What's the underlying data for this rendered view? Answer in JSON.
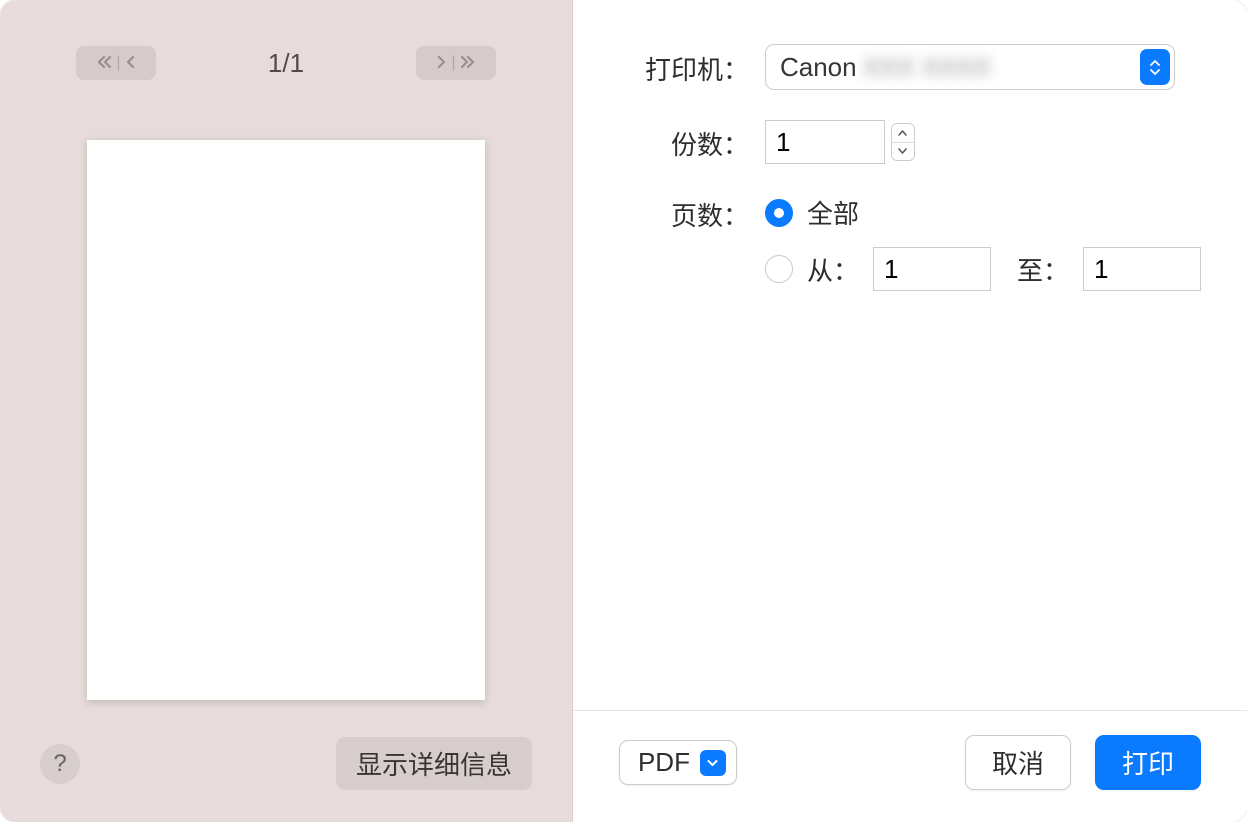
{
  "preview": {
    "page_indicator": "1/1",
    "show_details_label": "显示详细信息",
    "help_label": "?"
  },
  "form": {
    "printer_label": "打印机：",
    "printer_value": "Canon",
    "copies_label": "份数：",
    "copies_value": "1",
    "pages_label": "页数：",
    "pages_all_label": "全部",
    "pages_from_label": "从：",
    "pages_from_value": "1",
    "pages_to_label": "至：",
    "pages_to_value": "1"
  },
  "footer": {
    "pdf_label": "PDF",
    "cancel_label": "取消",
    "print_label": "打印"
  }
}
